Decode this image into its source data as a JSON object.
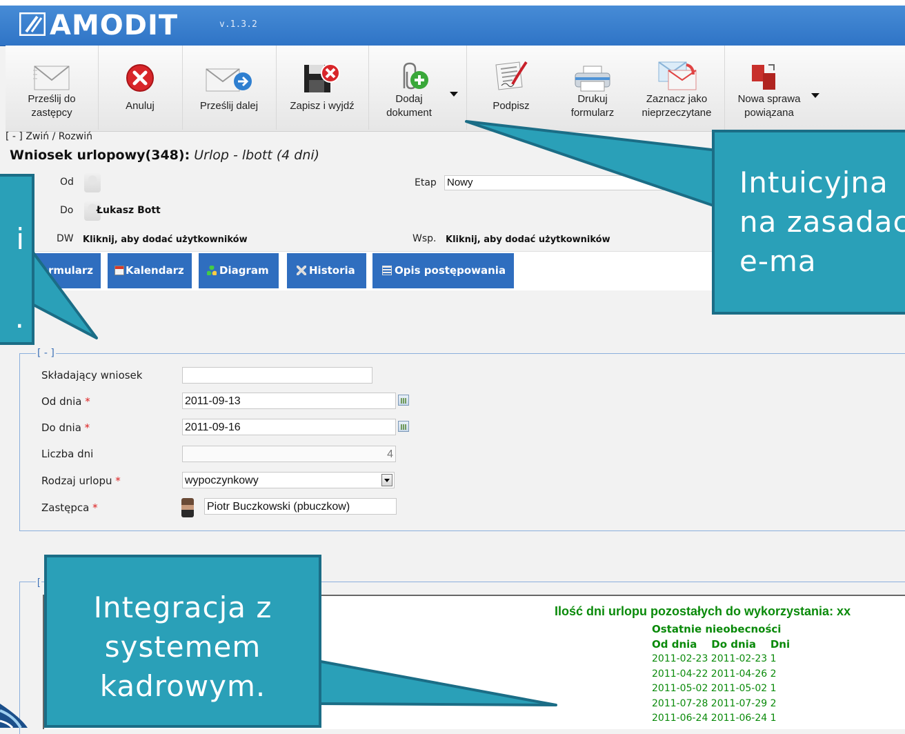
{
  "app": {
    "logo": "AMODIT",
    "version": "v.1.3.2"
  },
  "toolbar": {
    "forward_substitute": "Prześlij do\nzastępcy",
    "cancel": "Anuluj",
    "forward": "Prześlij dalej",
    "save_exit": "Zapisz i wyjdź",
    "add_document": "Dodaj\ndokument",
    "sign": "Podpisz",
    "print_form": "Drukuj\nformularz",
    "mark_unread": "Zaznacz jako\nnieprzeczytane",
    "new_related_case": "Nowa sprawa\npowiązana"
  },
  "collapse_label": "[ - ] Zwiń / Rozwiń",
  "case": {
    "title_bold": "Wniosek urlopowy(348):",
    "title_italic": "Urlop - lbott (4 dni)"
  },
  "meta": {
    "od_label": "Od",
    "do_label": "Do",
    "do_value": "Łukasz Bott",
    "dw_label": "DW",
    "dw_value": "Kliknij, aby dodać użytkowników",
    "etap_label": "Etap",
    "etap_value": "Nowy",
    "wsp_label": "Wsp.",
    "wsp_value": "Kliknij, aby dodać użytkowników"
  },
  "tabs": [
    "Formularz",
    "Kalendarz",
    "Diagram",
    "Historia",
    "Opis postępowania"
  ],
  "form": {
    "legend": "[ - ]",
    "applicant_label": "Składający wniosek",
    "applicant_value": "",
    "from_label": "Od dnia",
    "from_value": "2011-09-13",
    "to_label": "Do dnia",
    "to_value": "2011-09-16",
    "days_label": "Liczba dni",
    "days_value": "4",
    "type_label": "Rodzaj urlopu",
    "type_value": "wypoczynkowy",
    "substitute_label": "Zastępca",
    "substitute_value": "Piotr Buczkowski (pbuczkow)",
    "required_mark": "*"
  },
  "second_box": {
    "legend": "["
  },
  "hr": {
    "title": "Ilość dni urlopu pozostałych do wykorzystania: xx",
    "subtitle": "Ostatnie nieobecności",
    "head": "Od dnia    Do dnia    Dni",
    "rows": [
      "2011-02-23 2011-02-23 1",
      "2011-04-22 2011-04-26 2",
      "2011-05-02 2011-05-02 1",
      "2011-07-28 2011-07-29 2",
      "2011-06-24 2011-06-24 1"
    ]
  },
  "callouts": {
    "top_right": "Intuicyjna\nna zasadac\ne-ma",
    "left": "i\n\n.",
    "bottom": "Integracja z\nsystemem\nkadrowym."
  },
  "colors": {
    "header": "#2f74c6",
    "tab": "#2f6ebf",
    "callout": "#2aa0b8",
    "callout_border": "#1b6d86",
    "hr_text": "#0a8a0a"
  }
}
